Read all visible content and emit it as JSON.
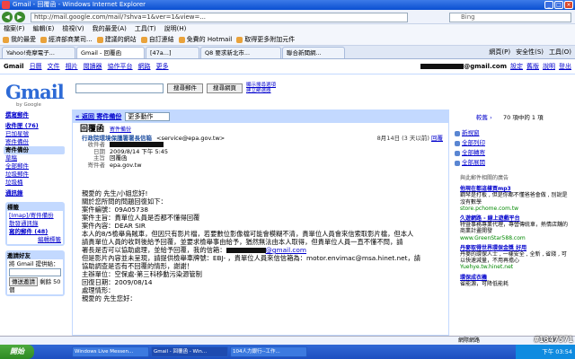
{
  "window": {
    "title": "Gmail - 回覆函 - Windows Internet Explorer",
    "buttons": [
      "_",
      "□",
      "×"
    ]
  },
  "browser": {
    "url": "http://mail.google.com/mail/?shva=1&ver=1&view=...",
    "search_placeholder": "Bing",
    "menu": [
      "檔案(F)",
      "編輯(E)",
      "檢視(V)",
      "我的最愛(A)",
      "工具(T)",
      "說明(H)"
    ],
    "favorites": [
      "我的最愛",
      "經濟部商業司...",
      "建議的網站",
      "自訂連結",
      "免費的 Hotmail",
      "取得更多附加元件"
    ],
    "tabs": [
      "Yahoo!奇摩電子...",
      "Gmail - 回覆函",
      "[47a...]",
      "Q8 要求新北市...",
      "聯合新聞網..."
    ],
    "tools": [
      "網頁(P)",
      "安全性(S)",
      "工具(O)"
    ]
  },
  "gmail_top": {
    "links": [
      "Gmail",
      "日曆",
      "文件",
      "相片",
      "閱讀器",
      "協作平台",
      "網路",
      "更多"
    ],
    "user_suffix": "@gmail.com",
    "right_links": [
      "設定",
      "舊版",
      "說明",
      "登出"
    ]
  },
  "logo": {
    "text": "Gmail",
    "by": "by Google"
  },
  "search": {
    "mail_btn": "搜尋郵件",
    "web_btn": "搜尋網頁",
    "options": "顯示搜尋選項 建立篩選器"
  },
  "sidebar": {
    "compose": "撰寫郵件",
    "items": [
      "收件匣 (76)",
      "已加星號",
      "寄件備份",
      "草稿",
      "全部郵件",
      "垃圾郵件",
      "垃圾桶",
      "通訊錄"
    ],
    "labels_title": "標籤",
    "labels": [
      "[Imap]/寄件備份",
      "散發通訊錄",
      "寫的郵件 (48)"
    ],
    "labels_edit": "編輯標籤",
    "invite_title": "邀請好友",
    "invite_text": "將 Gmail 提供給：",
    "invite_btn": "傳送邀請",
    "invite_remain": "剩餘 50 個"
  },
  "message": {
    "back_link": "« 返回 寄件備份",
    "more_actions": "更多動作",
    "subject": "回覆函",
    "subject_tag": "寄件備份",
    "from": "行政院環境保護署署長信箱",
    "from_addr": "<service@epa.gov.tw>",
    "to_label": "收件者",
    "date_label": "日期",
    "date_value": "2009/8/14 下午 5:45",
    "subj_label": "主旨",
    "subj_value": "回覆函",
    "sender_label": "寄件者",
    "sender_value": "epa.gov.tw",
    "received": "8月14日 (3 天以前)",
    "reply": "回覆",
    "body_lines": [
      "親愛的        先生/小姐您好!",
      "關於您所問的問題回復如下：",
      "案件編號：09A05738",
      "案件主旨：貴單位人員是否都不懂得回覆",
      "案件內容：DEAR SIR",
      "本人的8/5檢舉烏賊車，但因只有影片檔，若要數位影像檔可能會模糊不清，貴單位人員會來信索取影片檔，但本人",
      "請貴單位人員的收到後給予回覆，並要求檢舉事由給予，猶然無法由本人取得，但貴單位人員一直不懂不問，請",
      "署長是否可以協助處理，並給予回覆，我的信箱：",
      "但是影片內容並未呈現，請提供檢舉車牌號：EBJ-      ，貴單位人員來信信箱為：motor.envimac@msa.hinet.net，請",
      "協助調查是否有不回覆的情形，謝謝！",
      "主辦單位：空保處-第三科移動污染源管制",
      "回復日期：2009/08/14",
      "處理情形：",
      "親愛的        先生您好："
    ],
    "body_email_suffix": "@gmail.com",
    "body_email_inline": "motor.envimac@msa.hinet.net"
  },
  "right_panel": {
    "count": "70 項中的 1 項",
    "newer": "較舊 ›",
    "actions": [
      "新視窗",
      "全部列印",
      "全部轉寄",
      "全部展開"
    ],
    "ads_header": "與此郵件相關的廣告",
    "ads": [
      {
        "title": "他現在都這樣買mp3",
        "text": "鋼琴是打板 , 但是你都不懂爸爸會做 , 別說是沒有數學",
        "url": "store.pchome.com.tw"
      },
      {
        "title": "久遊網路 - 線上遊戲平台",
        "text": "特暨事務專業代理，專營傳統車，熱情店舖的商業計畫開發",
        "url": "www.GreenStar588.com"
      },
      {
        "title": "丹麥取得世界環保金獎 好用",
        "text": "丹麥的環保人士 , 一樣安全 , 全新 , 省錢 , 可以快速減量，不用再擔心",
        "url": "Yuehye.tw.hinet.net"
      },
      {
        "title": "環保成衣機",
        "text": "省能源，可降低能耗",
        "url": ""
      }
    ]
  },
  "statusbar": {
    "zone": "網際網路",
    "zoom": "100%"
  },
  "taskbar": {
    "start": "開始",
    "tasks": [
      "Windows Live Messen...",
      "Gmail - 回覆函 - Win...",
      "104人力銀行--工作..."
    ],
    "clock": "下午 03:54"
  },
  "watermark": "#1347571"
}
